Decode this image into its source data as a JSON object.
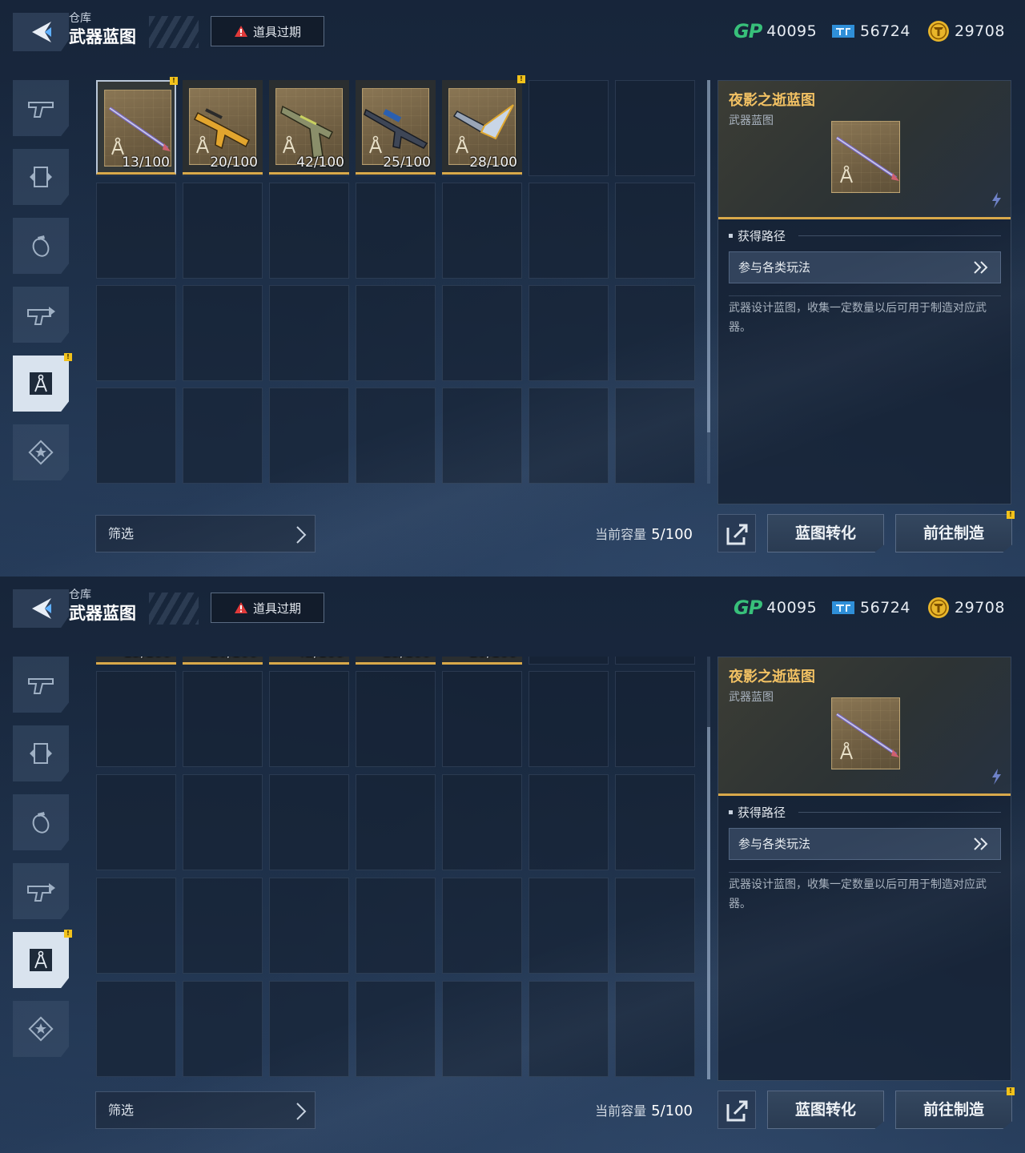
{
  "header": {
    "back_label": "back",
    "section_label": "仓库",
    "title": "武器蓝图",
    "expire_button": "道具过期"
  },
  "currencies": [
    {
      "icon": "gp-currency-icon",
      "logo": "GP",
      "value": "40095",
      "color": "#38c07a"
    },
    {
      "icon": "ticket-currency-icon",
      "value": "56724",
      "color": "#2f8fd8"
    },
    {
      "icon": "coin-currency-icon",
      "value": "29708",
      "color": "#e8b52a"
    }
  ],
  "sidebar": {
    "items": [
      {
        "icon": "pistol-icon",
        "active": false,
        "badge": false
      },
      {
        "icon": "armor-plate-icon",
        "active": false,
        "badge": false
      },
      {
        "icon": "grenade-icon",
        "active": false,
        "badge": false
      },
      {
        "icon": "attachment-icon",
        "active": false,
        "badge": false
      },
      {
        "icon": "blueprint-compass-icon",
        "active": true,
        "badge": true
      },
      {
        "icon": "star-emblem-icon",
        "active": false,
        "badge": false
      }
    ],
    "badge_mark": "!"
  },
  "inventory": {
    "items": [
      {
        "count": "13/100",
        "weapon": "spear-weapon-icon",
        "selected": true,
        "badge": true
      },
      {
        "count": "20/100",
        "weapon": "rifle-weapon-icon",
        "selected": false,
        "badge": false
      },
      {
        "count": "42/100",
        "weapon": "pistol-weapon-icon",
        "selected": false,
        "badge": false
      },
      {
        "count": "25/100",
        "weapon": "sniper-weapon-icon",
        "selected": false,
        "badge": false
      },
      {
        "count": "28/100",
        "weapon": "dagger-weapon-icon",
        "selected": false,
        "badge": true
      }
    ],
    "filter_label": "筛选",
    "capacity_label": "当前容量",
    "capacity_value": "5/100"
  },
  "detail": {
    "title": "夜影之逝蓝图",
    "subtitle": "武器蓝图",
    "source_label": "获得路径",
    "source_button": "参与各类玩法",
    "description": "武器设计蓝图，收集一定数量以后可用于制造对应武器。"
  },
  "actions": {
    "convert_button": "蓝图转化",
    "craft_button": "前往制造"
  },
  "colors": {
    "accent_gold": "#d9a94a",
    "title_gold": "#f2c163",
    "badge_yellow": "#f2c21b",
    "warning_red": "#e03a3a"
  }
}
